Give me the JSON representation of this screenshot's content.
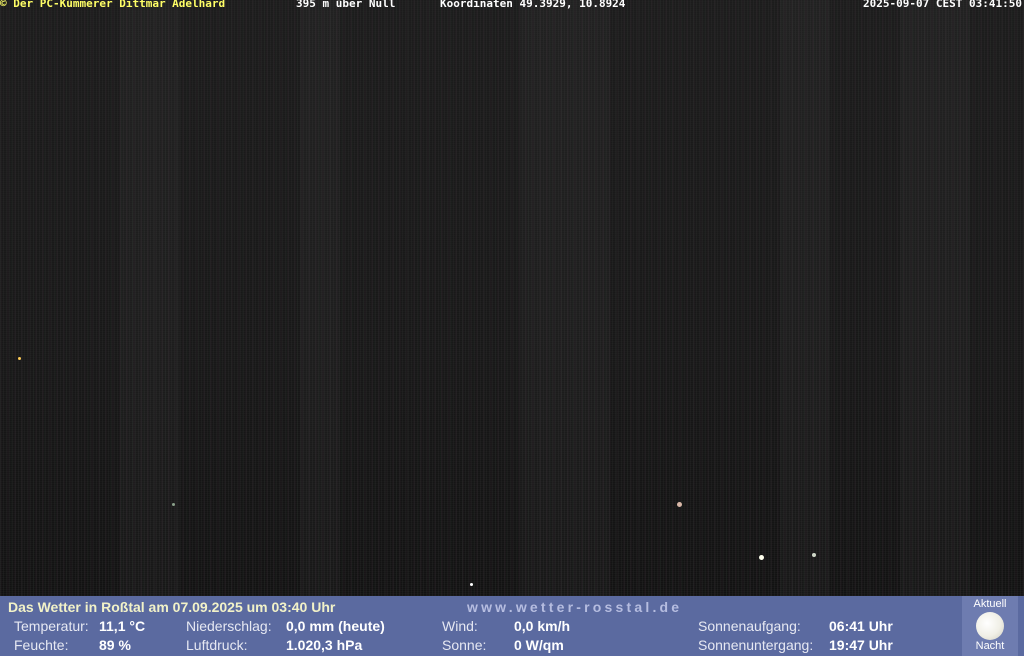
{
  "camera": {
    "copyright": "© Der PC-Kümmerer Dittmar Adelhard",
    "altitude": "395 m über Null",
    "coordinates": "Koordinaten 49.3929, 10.8924",
    "timestamp": "2025-09-07 CEST 03:41:50"
  },
  "weather": {
    "title": "Das Wetter in Roßtal am 07.09.2025 um 03:40 Uhr",
    "url": "www.wetter-rosstal.de",
    "temperature_label": "Temperatur:",
    "temperature_value": "11,1 °C",
    "humidity_label": "Feuchte:",
    "humidity_value": "89 %",
    "precip_label": "Niederschlag:",
    "precip_value": "0,0 mm (heute)",
    "pressure_label": "Luftdruck:",
    "pressure_value": "1.020,3 hPa",
    "wind_label": "Wind:",
    "wind_value": "0,0 km/h",
    "sun_label": "Sonne:",
    "sun_value": "0 W/qm",
    "sunrise_label": "Sonnenaufgang:",
    "sunrise_value": "06:41 Uhr",
    "sunset_label": "Sonnenuntergang:",
    "sunset_value": "19:47 Uhr",
    "moon_top": "Aktuell",
    "moon_bottom": "Nacht",
    "moon_icon": "full-moon-icon"
  }
}
